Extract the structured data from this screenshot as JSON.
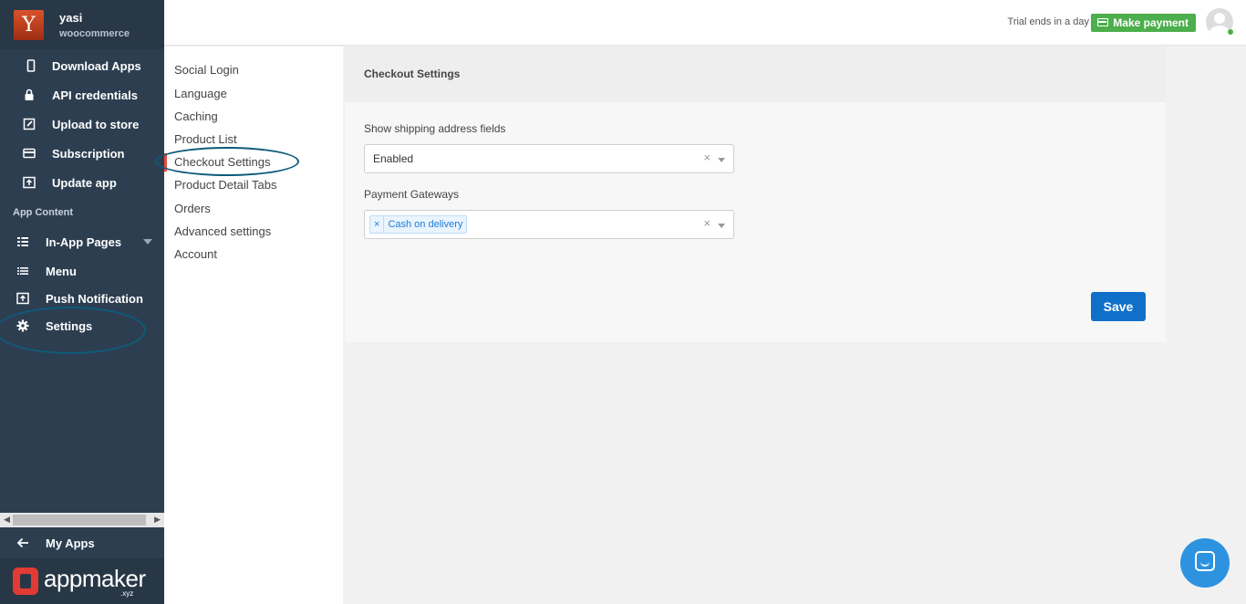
{
  "sidebar": {
    "user": {
      "initial": "Y",
      "name": "yasi",
      "platform": "woocommerce"
    },
    "top_items": [
      {
        "label": "Download Apps",
        "icon": "phone-icon"
      },
      {
        "label": "API credentials",
        "icon": "lock-icon"
      },
      {
        "label": "Upload to store",
        "icon": "edit-icon"
      },
      {
        "label": "Subscription",
        "icon": "credit-card-icon"
      },
      {
        "label": "Update app",
        "icon": "upload-icon"
      }
    ],
    "section_label": "App Content",
    "content_items": [
      {
        "label": "In-App Pages",
        "icon": "grid-icon"
      },
      {
        "label": "Menu",
        "icon": "list-icon"
      },
      {
        "label": "Push Notification",
        "icon": "notification-icon"
      },
      {
        "label": "Settings",
        "icon": "gear-icon"
      }
    ],
    "my_apps": "My Apps",
    "brand": {
      "name": "appmaker",
      "suffix": ".xyz"
    }
  },
  "topbar": {
    "trial_text": "Trial ends in a day",
    "pay_label": "Make payment"
  },
  "submenu": {
    "items": [
      "Social Login",
      "Language",
      "Caching",
      "Product List",
      "Checkout Settings",
      "Product Detail Tabs",
      "Orders",
      "Advanced settings",
      "Account"
    ],
    "active": "Checkout Settings"
  },
  "panel": {
    "title": "Checkout Settings",
    "shipping_label": "Show shipping address fields",
    "shipping_value": "Enabled",
    "gateways_label": "Payment Gateways",
    "gateway_tag": "Cash on delivery",
    "tag_remove": "×",
    "clear": "×",
    "save_label": "Save"
  },
  "colors": {
    "sidebar": "#2d3e50",
    "accent": "#1070c9",
    "pay": "#4cae4c",
    "active_marker": "#e74c3c"
  }
}
